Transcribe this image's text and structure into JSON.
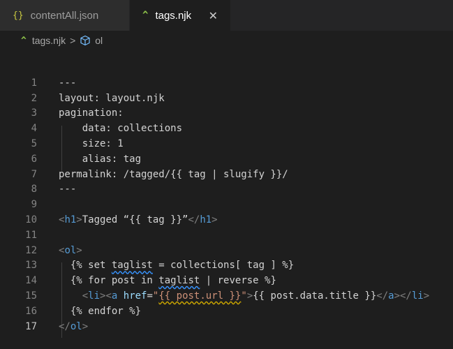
{
  "tabs": [
    {
      "icon": "{}",
      "label": "contentAll.json",
      "active": false
    },
    {
      "icon": "^",
      "label": "tags.njk",
      "active": true,
      "close": "✕"
    }
  ],
  "breadcrumb": {
    "file": "tags.njk",
    "separator": ">",
    "symbol": "ol"
  },
  "lines": [
    {
      "n": "1",
      "text": "---"
    },
    {
      "n": "2",
      "text": "layout: layout.njk"
    },
    {
      "n": "3",
      "text": "pagination:"
    },
    {
      "n": "4",
      "text": "    data: collections"
    },
    {
      "n": "5",
      "text": "    size: 1"
    },
    {
      "n": "6",
      "text": "    alias: tag"
    },
    {
      "n": "7",
      "text": "permalink: /tagged/{{ tag | slugify }}/"
    },
    {
      "n": "8",
      "text": "---"
    },
    {
      "n": "9",
      "text": ""
    },
    {
      "n": "10",
      "text": "<h1>Tagged “{{ tag }}”</h1>"
    },
    {
      "n": "11",
      "text": ""
    },
    {
      "n": "12",
      "text": "<ol>"
    },
    {
      "n": "13",
      "text": "  {% set taglist = collections[ tag ] %}"
    },
    {
      "n": "14",
      "text": "  {% for post in taglist | reverse %}"
    },
    {
      "n": "15",
      "text": "    <li><a href=\"{{ post.url }}\">{{ post.data.title }}</a></li>"
    },
    {
      "n": "16",
      "text": "  {% endfor %}"
    },
    {
      "n": "17",
      "text": "</ol>"
    }
  ],
  "current_line": "17",
  "colors": {
    "tag": "#569cd6",
    "attr": "#9cdcfe",
    "string": "#ce9178",
    "text": "#d4d4d4",
    "bracket": "#808080"
  }
}
